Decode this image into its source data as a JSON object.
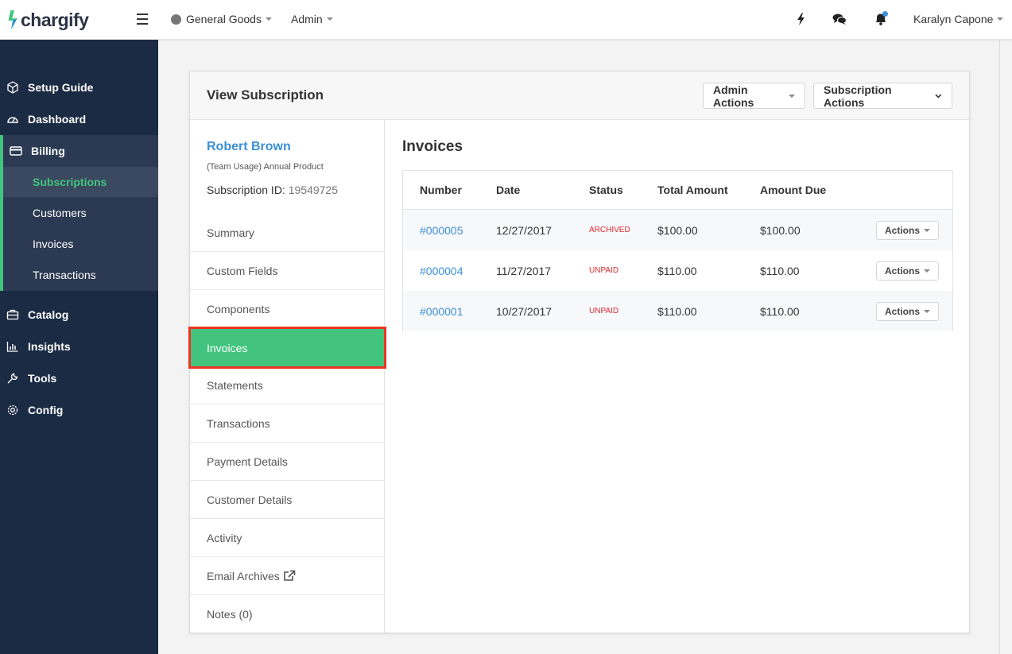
{
  "app": {
    "brand": "chargify",
    "brand_color": "#42c47e"
  },
  "topbar": {
    "site_name": "General Goods",
    "admin_label": "Admin",
    "user_name": "Karalyn Capone"
  },
  "sidebar": {
    "items": [
      {
        "label": "Setup Guide",
        "icon": "cube-icon"
      },
      {
        "label": "Dashboard",
        "icon": "gauge-icon"
      },
      {
        "label": "Billing",
        "icon": "credit-card-icon"
      },
      {
        "label": "Catalog",
        "icon": "briefcase-icon"
      },
      {
        "label": "Insights",
        "icon": "bar-chart-icon"
      },
      {
        "label": "Tools",
        "icon": "wrench-icon"
      },
      {
        "label": "Config",
        "icon": "gear-icon"
      }
    ],
    "billing_sub": [
      "Subscriptions",
      "Customers",
      "Invoices",
      "Transactions"
    ]
  },
  "card": {
    "title": "View Subscription",
    "admin_actions": "Admin Actions",
    "subscription_actions": "Subscription Actions"
  },
  "customer": {
    "name": "Robert Brown",
    "product": "(Team Usage) Annual Product",
    "subscription_id_label": "Subscription ID:",
    "subscription_id": "19549725"
  },
  "tabs": [
    "Summary",
    "Custom Fields",
    "Components",
    "Invoices",
    "Statements",
    "Transactions",
    "Payment Details",
    "Customer Details",
    "Activity",
    "Email Archives",
    "Notes (0)"
  ],
  "invoices": {
    "title": "Invoices",
    "columns": [
      "Number",
      "Date",
      "Status",
      "Total Amount",
      "Amount Due"
    ],
    "rows": [
      {
        "number": "#000005",
        "date": "12/27/2017",
        "status": "ARCHIVED",
        "total": "$100.00",
        "due": "$100.00",
        "action": "Actions"
      },
      {
        "number": "#000004",
        "date": "11/27/2017",
        "status": "UNPAID",
        "total": "$110.00",
        "due": "$110.00",
        "action": "Actions"
      },
      {
        "number": "#000001",
        "date": "10/27/2017",
        "status": "UNPAID",
        "total": "$110.00",
        "due": "$110.00",
        "action": "Actions"
      }
    ]
  }
}
